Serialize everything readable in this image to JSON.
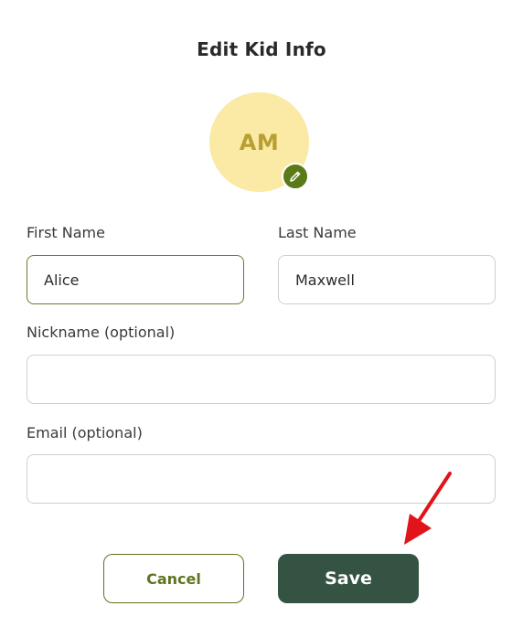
{
  "header": {
    "title": "Edit Kid Info"
  },
  "avatar": {
    "initials": "AM",
    "edit_icon": "pencil-icon",
    "background_color": "#fbe9a6",
    "initials_color": "#b7a02f",
    "badge_color": "#5a7a17"
  },
  "form": {
    "first_name": {
      "label": "First Name",
      "value": "Alice"
    },
    "last_name": {
      "label": "Last Name",
      "value": "Maxwell"
    },
    "nickname": {
      "label": "Nickname (optional)",
      "value": ""
    },
    "email": {
      "label": "Email (optional)",
      "value": ""
    }
  },
  "actions": {
    "cancel_label": "Cancel",
    "save_label": "Save",
    "save_color": "#355343",
    "cancel_color": "#5f7420"
  },
  "annotation": {
    "icon": "red-arrow-icon",
    "color": "#e0141a"
  }
}
